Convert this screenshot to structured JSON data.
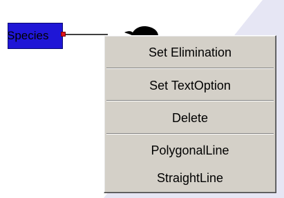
{
  "node": {
    "label": "Species"
  },
  "context_menu": {
    "items": [
      {
        "label": "Set Elimination"
      },
      {
        "label": "Set TextOption"
      },
      {
        "label": "Delete"
      },
      {
        "label": "PolygonalLine"
      },
      {
        "label": "StraightLine"
      }
    ]
  },
  "icons": {
    "connector": "black-blob-icon"
  },
  "colors": {
    "node_fill": "#1f16d6",
    "handle": "#e0141e",
    "menu_bg": "#d4d0c8",
    "background_wedge": "#e6e6f4"
  }
}
